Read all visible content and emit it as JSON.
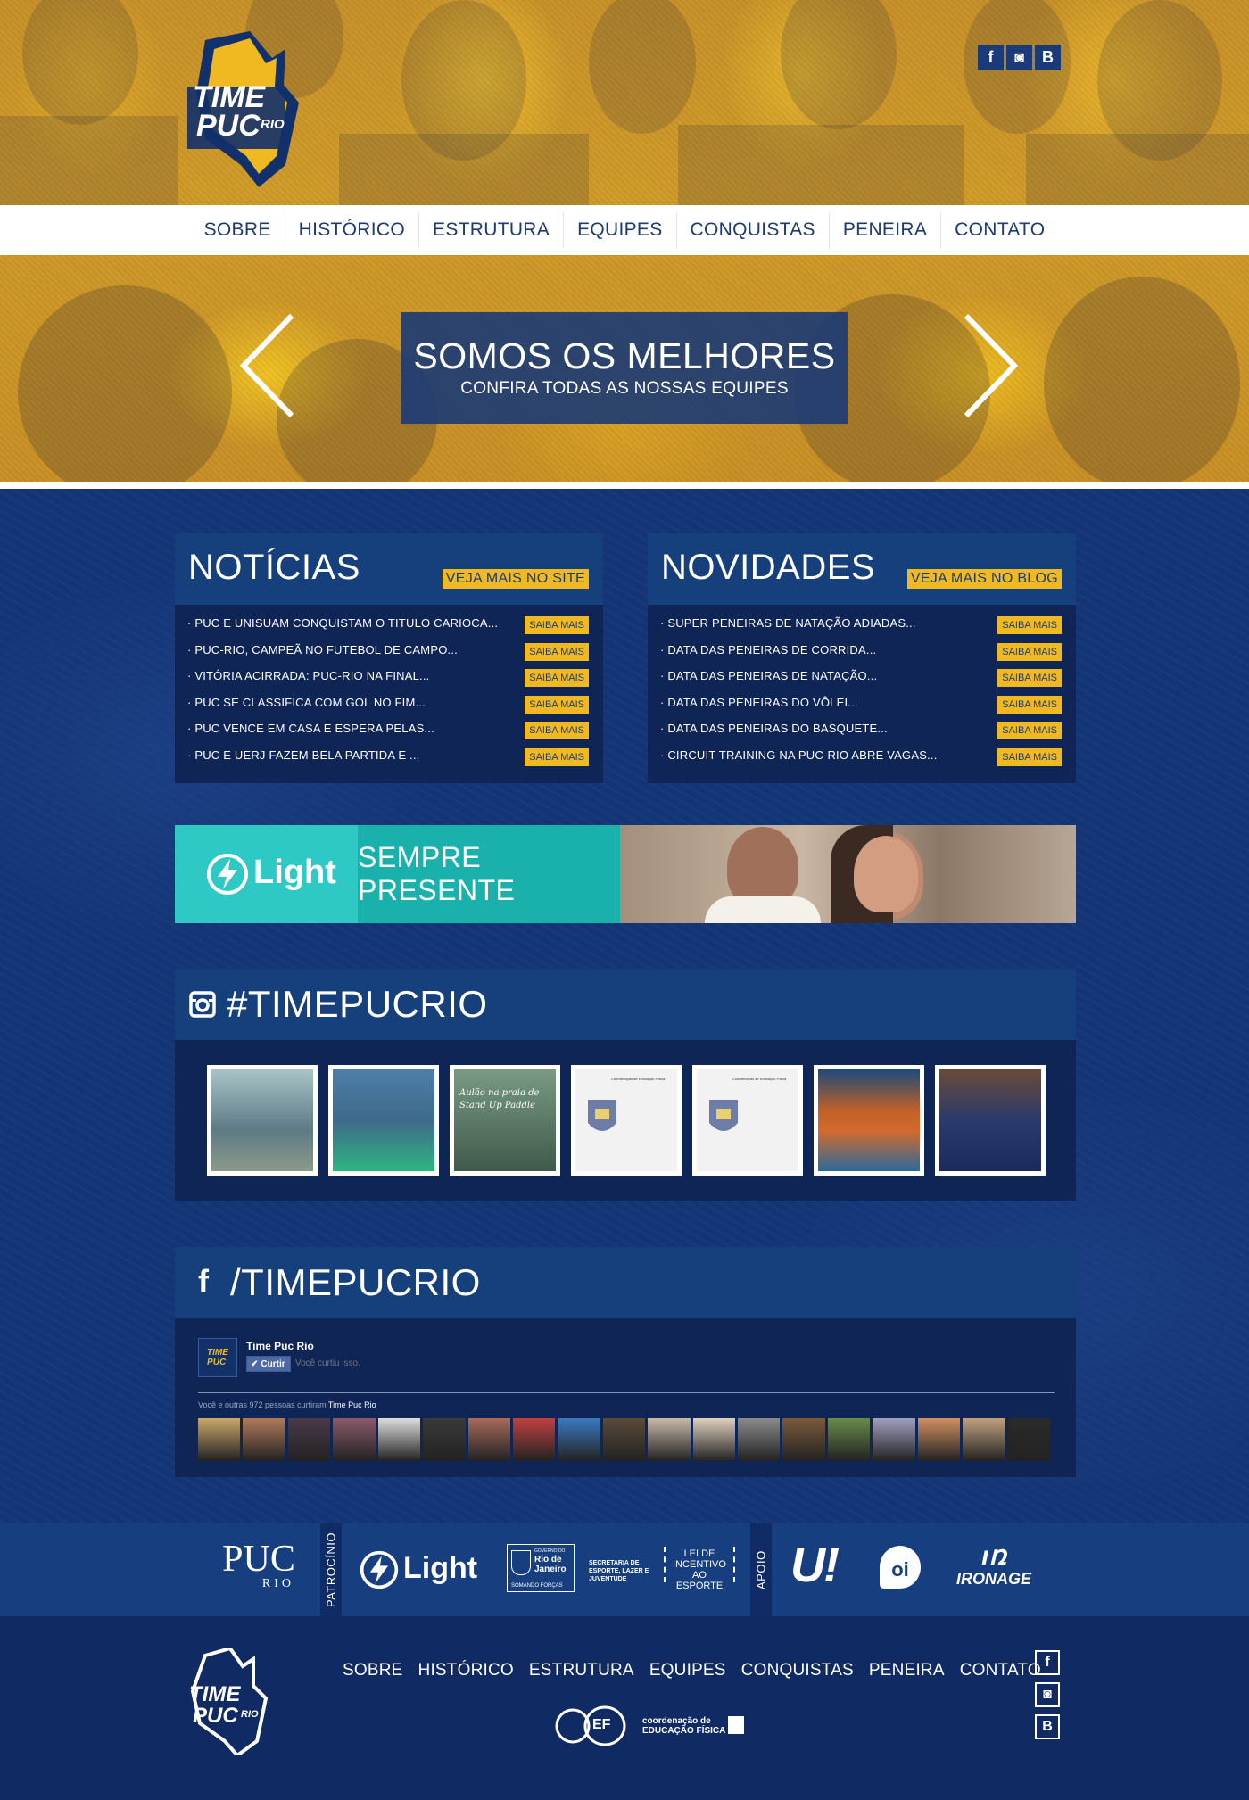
{
  "brand": {
    "logo_line1": "TIME",
    "logo_line2": "PUC",
    "logo_rio": "RIO"
  },
  "top_social": [
    "f",
    "◙",
    "B"
  ],
  "nav": [
    "SOBRE",
    "HISTÓRICO",
    "ESTRUTURA",
    "EQUIPES",
    "CONQUISTAS",
    "PENEIRA",
    "CONTATO"
  ],
  "hero": {
    "title": "SOMOS OS MELHORES",
    "subtitle": "CONFIRA TODAS AS NOSSAS EQUIPES"
  },
  "noticias": {
    "title": "NOTÍCIAS",
    "more": "VEJA MAIS NO SITE",
    "button": "SAIBA MAIS",
    "items": [
      "· PUC E UNISUAM CONQUISTAM O TITULO CARIOCA...",
      "· PUC-RIO, CAMPEÃ NO FUTEBOL DE CAMPO...",
      "· VITÓRIA ACIRRADA: PUC-RIO NA FINAL...",
      "· PUC SE CLASSIFICA COM GOL NO FIM...",
      "· PUC VENCE EM CASA E ESPERA PELAS...",
      "· PUC E UERJ FAZEM BELA PARTIDA E ..."
    ]
  },
  "novidades": {
    "title": "NOVIDADES",
    "more": "VEJA MAIS NO BLOG",
    "button": "SAIBA MAIS",
    "items": [
      "· SUPER PENEIRAS DE NATAÇÃO ADIADAS...",
      "· DATA DAS PENEIRAS DE CORRIDA...",
      "· DATA DAS PENEIRAS DE NATAÇÃO...",
      "· DATA DAS PENEIRAS DO VÔLEI...",
      "· DATA DAS PENEIRAS DO BASQUETE...",
      "· CIRCUIT TRAINING NA PUC-RIO ABRE VAGAS..."
    ]
  },
  "light_ad": {
    "brand": "Light",
    "slogan": "SEMPRE PRESENTE"
  },
  "instagram": {
    "title": "#TIMEPUCRIO",
    "thumbs": [
      {
        "bg": "#5d7a84",
        "caption": ""
      },
      {
        "bg": "#3e6a8a",
        "caption": ""
      },
      {
        "bg": "#5c7a6a",
        "caption": "Aulão na praia de Stand Up Paddle"
      },
      {
        "bg": "#f2f2f2",
        "caption": "Coordenação de Educação Física"
      },
      {
        "bg": "#f2f2f2",
        "caption": "Coordenação de Educação Física"
      },
      {
        "bg": "#b54a2a",
        "caption": ""
      },
      {
        "bg": "#2a3a6a",
        "caption": ""
      }
    ]
  },
  "facebook": {
    "title": "/TIMEPUCRIO",
    "page_name": "Time Puc Rio",
    "like_button": "Curtir",
    "liked_text": "Você curtiu isso.",
    "likes_prefix": "Você e outras 972 pessoas curtiram ",
    "likes_page": "Time Puc Rio"
  },
  "sponsors": {
    "patrocinio": "PATROCÍNIO",
    "apoio": "APOIO",
    "puc": "PUC",
    "puc_rio": "RIO",
    "light": "Light",
    "gov1": "GOVERNO DO",
    "gov2": "Rio de",
    "gov3": "Janeiro",
    "gov4": "SOMANDO FORÇAS",
    "sec1": "SECRETARIA DE",
    "sec2": "ESPORTE, LAZER E",
    "sec3": "JUVENTUDE",
    "lei1": "LEI DE",
    "lei2": "INCENTIVO AO",
    "lei3": "ESPORTE",
    "u": "U!",
    "oi": "oi",
    "ironage": "IRONAGE"
  },
  "footer": {
    "nav": [
      "SOBRE",
      "HISTÓRICO",
      "ESTRUTURA",
      "EQUIPES",
      "CONQUISTAS",
      "PENEIRA",
      "CONTATO"
    ],
    "cef1": "coordenação de",
    "cef2": "EDUCAÇÃO FÍSICA",
    "cef_badge": "EF",
    "social": [
      "f",
      "◙",
      "B"
    ]
  },
  "colors": {
    "navy": "#143575",
    "panel": "#0e2556",
    "accent": "#f0b821",
    "teal": "#2cc4c0"
  }
}
